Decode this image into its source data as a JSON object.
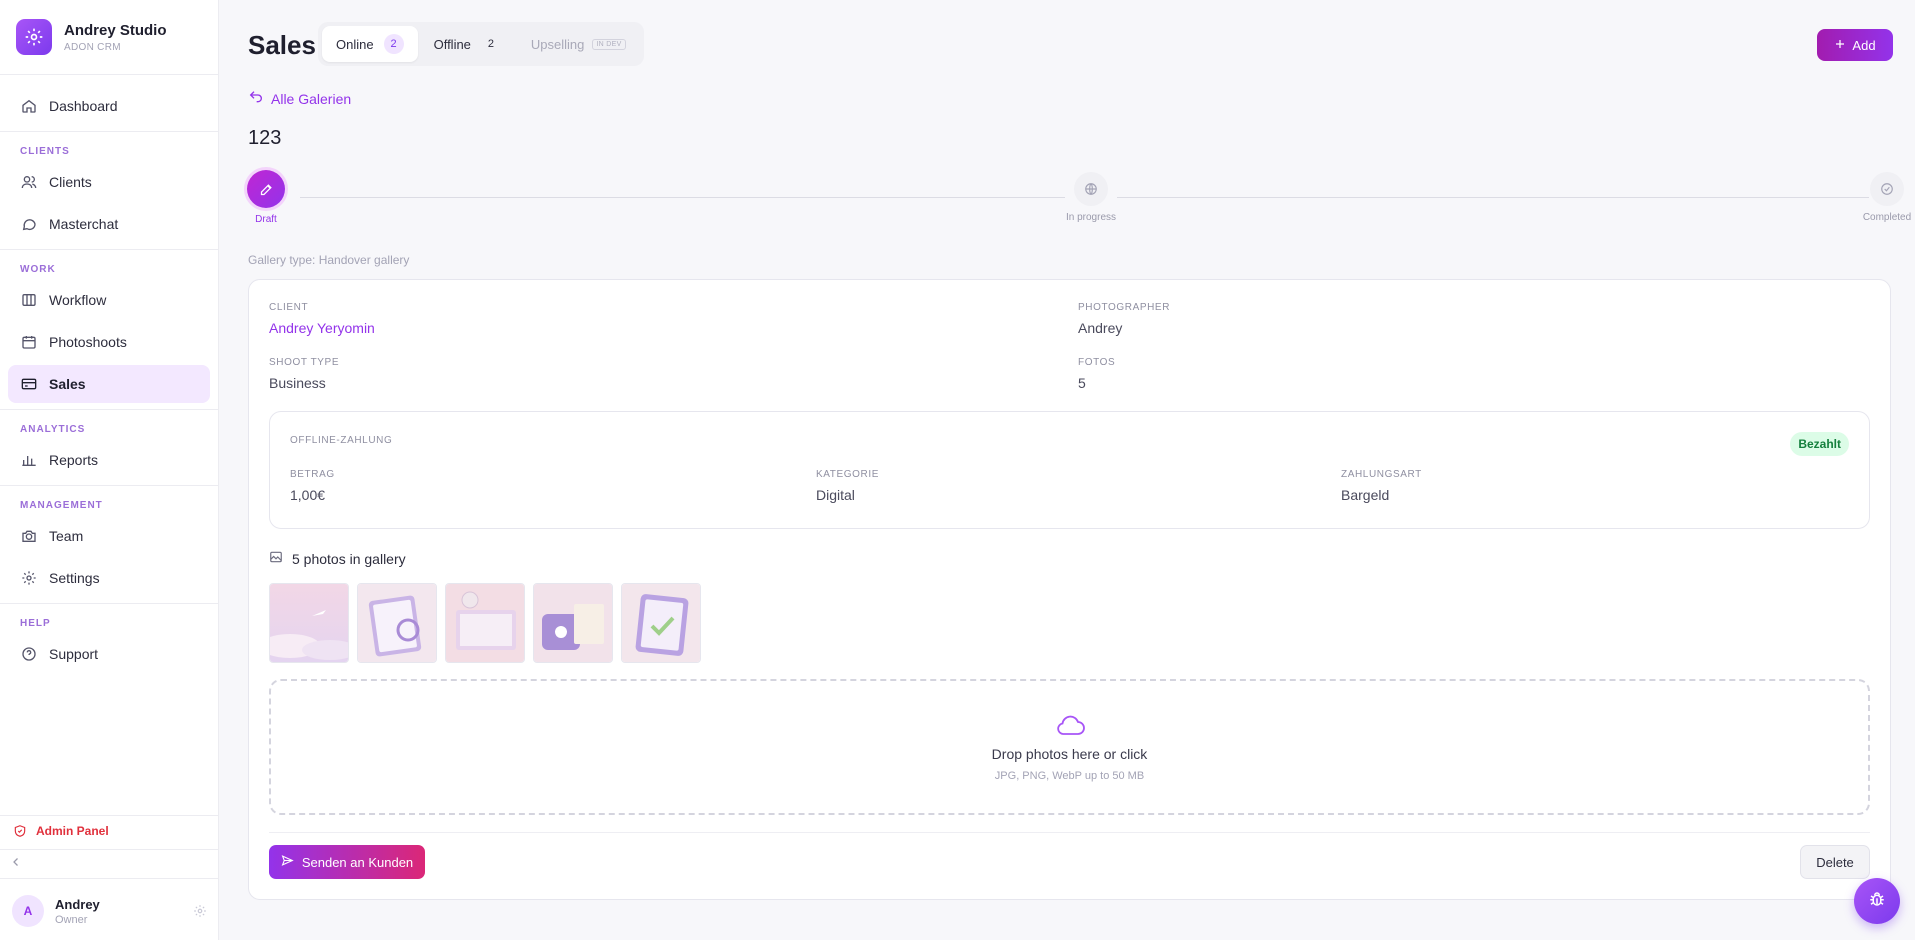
{
  "brand": {
    "name": "Andrey Studio",
    "subtitle": "ADON CRM"
  },
  "sidebar": {
    "dashboard": "Dashboard",
    "sections": {
      "clients": "CLIENTS",
      "work": "WORK",
      "analytics": "ANALYTICS",
      "management": "MANAGEMENT",
      "help": "HELP"
    },
    "items": {
      "clients": "Clients",
      "masterchat": "Masterchat",
      "workflow": "Workflow",
      "photoshoots": "Photoshoots",
      "sales": "Sales",
      "reports": "Reports",
      "team": "Team",
      "settings": "Settings",
      "support": "Support"
    },
    "admin_panel": "Admin Panel",
    "user": {
      "initial": "A",
      "name": "Andrey",
      "role": "Owner"
    }
  },
  "header": {
    "title": "Sales",
    "tabs": [
      {
        "label": "Online",
        "count": "2"
      },
      {
        "label": "Offline",
        "count": "2"
      },
      {
        "label": "Upselling",
        "badge": "IN DEV"
      }
    ],
    "add_label": "Add"
  },
  "back_link": "Alle Galerien",
  "gallery": {
    "title": "123",
    "type_text": "Gallery type: Handover gallery",
    "steps": [
      "Draft",
      "In progress",
      "Completed"
    ]
  },
  "details": {
    "client_label": "CLIENT",
    "client_value": "Andrey Yeryomin",
    "photographer_label": "PHOTOGRAPHER",
    "photographer_value": "Andrey",
    "shoot_type_label": "SHOOT TYPE",
    "shoot_type_value": "Business",
    "fotos_label": "FOTOS",
    "fotos_value": "5"
  },
  "payment": {
    "title": "OFFLINE-ZAHLUNG",
    "status": "Bezahlt",
    "amount_label": "BETRAG",
    "amount_value": "1,00€",
    "category_label": "KATEGORIE",
    "category_value": "Digital",
    "method_label": "ZAHLUNGSART",
    "method_value": "Bargeld"
  },
  "photos": {
    "heading": "5 photos in gallery",
    "dropzone_title": "Drop photos here or click",
    "dropzone_hint": "JPG, PNG, WebP up to 50 MB"
  },
  "actions": {
    "send": "Senden an Kunden",
    "delete": "Delete"
  },
  "colors": {
    "accent": "#9333ea",
    "paid_bg": "#dcfce7",
    "paid_text": "#15803d",
    "danger": "#e0303c"
  }
}
